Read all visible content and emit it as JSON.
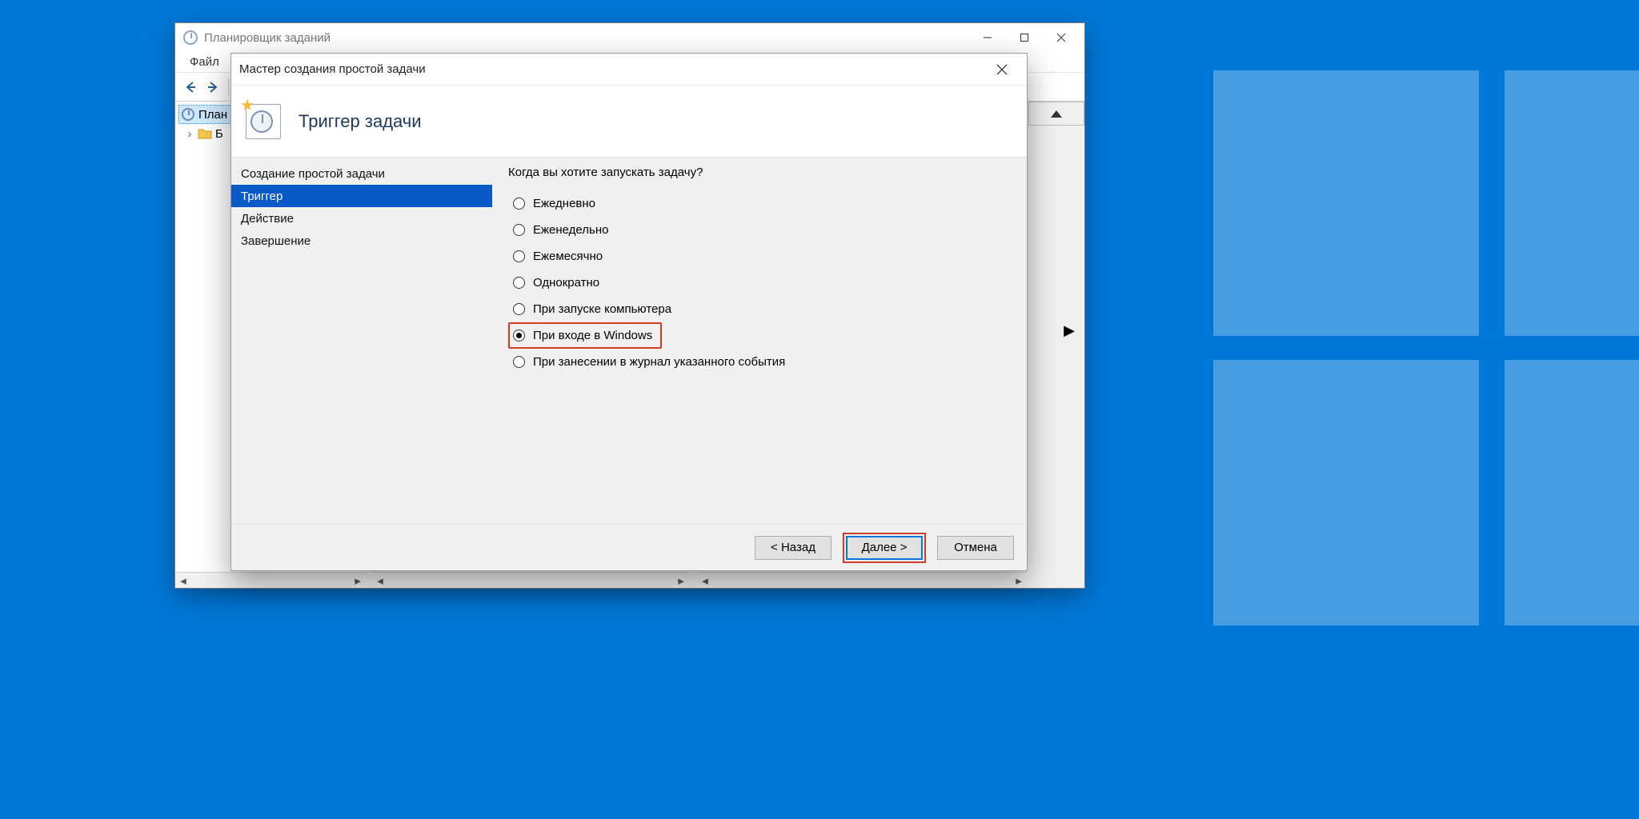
{
  "parent": {
    "title": "Планировщик заданий",
    "menu": {
      "file": "Файл"
    },
    "tree": {
      "root_short": "План",
      "lib_short": "Б"
    }
  },
  "wizard": {
    "window_title": "Мастер создания простой задачи",
    "header": "Триггер задачи",
    "steps": {
      "create": "Создание простой задачи",
      "trigger": "Триггер",
      "action": "Действие",
      "finish": "Завершение"
    },
    "question": "Когда вы хотите запускать задачу?",
    "options": {
      "daily": "Ежедневно",
      "weekly": "Еженедельно",
      "monthly": "Ежемесячно",
      "once": "Однократно",
      "startup": "При запуске компьютера",
      "logon": "При входе в Windows",
      "event": "При занесении в журнал указанного события"
    },
    "selected": "logon",
    "buttons": {
      "back": "< Назад",
      "next": "Далее >",
      "cancel": "Отмена"
    }
  }
}
